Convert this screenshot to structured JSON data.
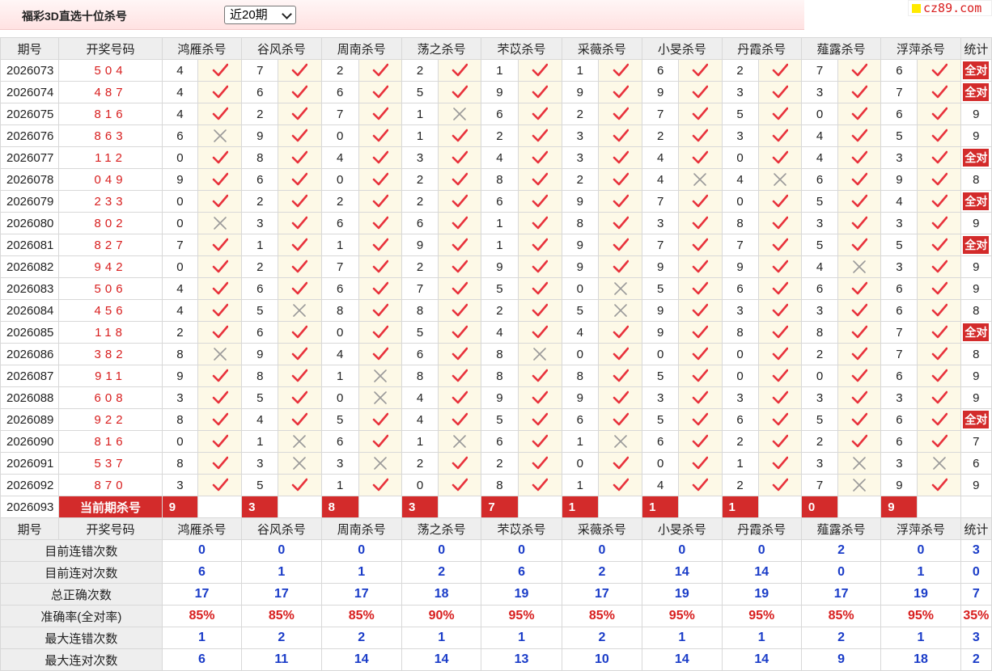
{
  "header": {
    "title": "福彩3D直选十位杀号",
    "period_select": "近20期",
    "site_logo": "cz89.com"
  },
  "columns": [
    "期号",
    "开奖号码",
    "鸿雁杀号",
    "谷风杀号",
    "周南杀号",
    "荡之杀号",
    "芣苡杀号",
    "采薇杀号",
    "小旻杀号",
    "丹霞杀号",
    "薤露杀号",
    "浮萍杀号",
    "统计"
  ],
  "rows": [
    {
      "issue": "2026073",
      "draw": "504",
      "picks": [
        [
          "4",
          "v"
        ],
        [
          "7",
          "v"
        ],
        [
          "2",
          "v"
        ],
        [
          "2",
          "v"
        ],
        [
          "1",
          "v"
        ],
        [
          "1",
          "v"
        ],
        [
          "6",
          "v"
        ],
        [
          "2",
          "v"
        ],
        [
          "7",
          "v"
        ],
        [
          "6",
          "v"
        ]
      ],
      "stat": "全对"
    },
    {
      "issue": "2026074",
      "draw": "487",
      "picks": [
        [
          "4",
          "v"
        ],
        [
          "6",
          "v"
        ],
        [
          "6",
          "v"
        ],
        [
          "5",
          "v"
        ],
        [
          "9",
          "v"
        ],
        [
          "9",
          "v"
        ],
        [
          "9",
          "v"
        ],
        [
          "3",
          "v"
        ],
        [
          "3",
          "v"
        ],
        [
          "7",
          "v"
        ]
      ],
      "stat": "全对"
    },
    {
      "issue": "2026075",
      "draw": "816",
      "picks": [
        [
          "4",
          "v"
        ],
        [
          "2",
          "v"
        ],
        [
          "7",
          "v"
        ],
        [
          "1",
          "x"
        ],
        [
          "6",
          "v"
        ],
        [
          "2",
          "v"
        ],
        [
          "7",
          "v"
        ],
        [
          "5",
          "v"
        ],
        [
          "0",
          "v"
        ],
        [
          "6",
          "v"
        ]
      ],
      "stat": "9"
    },
    {
      "issue": "2026076",
      "draw": "863",
      "picks": [
        [
          "6",
          "x"
        ],
        [
          "9",
          "v"
        ],
        [
          "0",
          "v"
        ],
        [
          "1",
          "v"
        ],
        [
          "2",
          "v"
        ],
        [
          "3",
          "v"
        ],
        [
          "2",
          "v"
        ],
        [
          "3",
          "v"
        ],
        [
          "4",
          "v"
        ],
        [
          "5",
          "v"
        ]
      ],
      "stat": "9"
    },
    {
      "issue": "2026077",
      "draw": "112",
      "picks": [
        [
          "0",
          "v"
        ],
        [
          "8",
          "v"
        ],
        [
          "4",
          "v"
        ],
        [
          "3",
          "v"
        ],
        [
          "4",
          "v"
        ],
        [
          "3",
          "v"
        ],
        [
          "4",
          "v"
        ],
        [
          "0",
          "v"
        ],
        [
          "4",
          "v"
        ],
        [
          "3",
          "v"
        ]
      ],
      "stat": "全对"
    },
    {
      "issue": "2026078",
      "draw": "049",
      "picks": [
        [
          "9",
          "v"
        ],
        [
          "6",
          "v"
        ],
        [
          "0",
          "v"
        ],
        [
          "2",
          "v"
        ],
        [
          "8",
          "v"
        ],
        [
          "2",
          "v"
        ],
        [
          "4",
          "x"
        ],
        [
          "4",
          "x"
        ],
        [
          "6",
          "v"
        ],
        [
          "9",
          "v"
        ]
      ],
      "stat": "8"
    },
    {
      "issue": "2026079",
      "draw": "233",
      "picks": [
        [
          "0",
          "v"
        ],
        [
          "2",
          "v"
        ],
        [
          "2",
          "v"
        ],
        [
          "2",
          "v"
        ],
        [
          "6",
          "v"
        ],
        [
          "9",
          "v"
        ],
        [
          "7",
          "v"
        ],
        [
          "0",
          "v"
        ],
        [
          "5",
          "v"
        ],
        [
          "4",
          "v"
        ]
      ],
      "stat": "全对"
    },
    {
      "issue": "2026080",
      "draw": "802",
      "picks": [
        [
          "0",
          "x"
        ],
        [
          "3",
          "v"
        ],
        [
          "6",
          "v"
        ],
        [
          "6",
          "v"
        ],
        [
          "1",
          "v"
        ],
        [
          "8",
          "v"
        ],
        [
          "3",
          "v"
        ],
        [
          "8",
          "v"
        ],
        [
          "3",
          "v"
        ],
        [
          "3",
          "v"
        ]
      ],
      "stat": "9"
    },
    {
      "issue": "2026081",
      "draw": "827",
      "picks": [
        [
          "7",
          "v"
        ],
        [
          "1",
          "v"
        ],
        [
          "1",
          "v"
        ],
        [
          "9",
          "v"
        ],
        [
          "1",
          "v"
        ],
        [
          "9",
          "v"
        ],
        [
          "7",
          "v"
        ],
        [
          "7",
          "v"
        ],
        [
          "5",
          "v"
        ],
        [
          "5",
          "v"
        ]
      ],
      "stat": "全对"
    },
    {
      "issue": "2026082",
      "draw": "942",
      "picks": [
        [
          "0",
          "v"
        ],
        [
          "2",
          "v"
        ],
        [
          "7",
          "v"
        ],
        [
          "2",
          "v"
        ],
        [
          "9",
          "v"
        ],
        [
          "9",
          "v"
        ],
        [
          "9",
          "v"
        ],
        [
          "9",
          "v"
        ],
        [
          "4",
          "x"
        ],
        [
          "3",
          "v"
        ]
      ],
      "stat": "9"
    },
    {
      "issue": "2026083",
      "draw": "506",
      "picks": [
        [
          "4",
          "v"
        ],
        [
          "6",
          "v"
        ],
        [
          "6",
          "v"
        ],
        [
          "7",
          "v"
        ],
        [
          "5",
          "v"
        ],
        [
          "0",
          "x"
        ],
        [
          "5",
          "v"
        ],
        [
          "6",
          "v"
        ],
        [
          "6",
          "v"
        ],
        [
          "6",
          "v"
        ]
      ],
      "stat": "9"
    },
    {
      "issue": "2026084",
      "draw": "456",
      "picks": [
        [
          "4",
          "v"
        ],
        [
          "5",
          "x"
        ],
        [
          "8",
          "v"
        ],
        [
          "8",
          "v"
        ],
        [
          "2",
          "v"
        ],
        [
          "5",
          "x"
        ],
        [
          "9",
          "v"
        ],
        [
          "3",
          "v"
        ],
        [
          "3",
          "v"
        ],
        [
          "6",
          "v"
        ]
      ],
      "stat": "8"
    },
    {
      "issue": "2026085",
      "draw": "118",
      "picks": [
        [
          "2",
          "v"
        ],
        [
          "6",
          "v"
        ],
        [
          "0",
          "v"
        ],
        [
          "5",
          "v"
        ],
        [
          "4",
          "v"
        ],
        [
          "4",
          "v"
        ],
        [
          "9",
          "v"
        ],
        [
          "8",
          "v"
        ],
        [
          "8",
          "v"
        ],
        [
          "7",
          "v"
        ]
      ],
      "stat": "全对"
    },
    {
      "issue": "2026086",
      "draw": "382",
      "picks": [
        [
          "8",
          "x"
        ],
        [
          "9",
          "v"
        ],
        [
          "4",
          "v"
        ],
        [
          "6",
          "v"
        ],
        [
          "8",
          "x"
        ],
        [
          "0",
          "v"
        ],
        [
          "0",
          "v"
        ],
        [
          "0",
          "v"
        ],
        [
          "2",
          "v"
        ],
        [
          "7",
          "v"
        ]
      ],
      "stat": "8"
    },
    {
      "issue": "2026087",
      "draw": "911",
      "picks": [
        [
          "9",
          "v"
        ],
        [
          "8",
          "v"
        ],
        [
          "1",
          "x"
        ],
        [
          "8",
          "v"
        ],
        [
          "8",
          "v"
        ],
        [
          "8",
          "v"
        ],
        [
          "5",
          "v"
        ],
        [
          "0",
          "v"
        ],
        [
          "0",
          "v"
        ],
        [
          "6",
          "v"
        ]
      ],
      "stat": "9"
    },
    {
      "issue": "2026088",
      "draw": "608",
      "picks": [
        [
          "3",
          "v"
        ],
        [
          "5",
          "v"
        ],
        [
          "0",
          "x"
        ],
        [
          "4",
          "v"
        ],
        [
          "9",
          "v"
        ],
        [
          "9",
          "v"
        ],
        [
          "3",
          "v"
        ],
        [
          "3",
          "v"
        ],
        [
          "3",
          "v"
        ],
        [
          "3",
          "v"
        ]
      ],
      "stat": "9"
    },
    {
      "issue": "2026089",
      "draw": "922",
      "picks": [
        [
          "8",
          "v"
        ],
        [
          "4",
          "v"
        ],
        [
          "5",
          "v"
        ],
        [
          "4",
          "v"
        ],
        [
          "5",
          "v"
        ],
        [
          "6",
          "v"
        ],
        [
          "5",
          "v"
        ],
        [
          "6",
          "v"
        ],
        [
          "5",
          "v"
        ],
        [
          "6",
          "v"
        ]
      ],
      "stat": "全对"
    },
    {
      "issue": "2026090",
      "draw": "816",
      "picks": [
        [
          "0",
          "v"
        ],
        [
          "1",
          "x"
        ],
        [
          "6",
          "v"
        ],
        [
          "1",
          "x"
        ],
        [
          "6",
          "v"
        ],
        [
          "1",
          "x"
        ],
        [
          "6",
          "v"
        ],
        [
          "2",
          "v"
        ],
        [
          "2",
          "v"
        ],
        [
          "6",
          "v"
        ]
      ],
      "stat": "7"
    },
    {
      "issue": "2026091",
      "draw": "537",
      "picks": [
        [
          "8",
          "v"
        ],
        [
          "3",
          "x"
        ],
        [
          "3",
          "x"
        ],
        [
          "2",
          "v"
        ],
        [
          "2",
          "v"
        ],
        [
          "0",
          "v"
        ],
        [
          "0",
          "v"
        ],
        [
          "1",
          "v"
        ],
        [
          "3",
          "x"
        ],
        [
          "3",
          "x"
        ]
      ],
      "stat": "6"
    },
    {
      "issue": "2026092",
      "draw": "870",
      "picks": [
        [
          "3",
          "v"
        ],
        [
          "5",
          "v"
        ],
        [
          "1",
          "v"
        ],
        [
          "0",
          "v"
        ],
        [
          "8",
          "v"
        ],
        [
          "1",
          "v"
        ],
        [
          "4",
          "v"
        ],
        [
          "2",
          "v"
        ],
        [
          "7",
          "x"
        ],
        [
          "9",
          "v"
        ]
      ],
      "stat": "9"
    }
  ],
  "current": {
    "issue": "2026093",
    "label": "当前期杀号",
    "kills": [
      "9",
      "3",
      "8",
      "3",
      "7",
      "1",
      "1",
      "1",
      "0",
      "9"
    ]
  },
  "stats": [
    {
      "label": "目前连错次数",
      "values": [
        "0",
        "0",
        "0",
        "0",
        "0",
        "0",
        "0",
        "0",
        "2",
        "0",
        "3"
      ],
      "red": false
    },
    {
      "label": "目前连对次数",
      "values": [
        "6",
        "1",
        "1",
        "2",
        "6",
        "2",
        "14",
        "14",
        "0",
        "1",
        "0"
      ],
      "red": false
    },
    {
      "label": "总正确次数",
      "values": [
        "17",
        "17",
        "17",
        "18",
        "19",
        "17",
        "19",
        "19",
        "17",
        "19",
        "7"
      ],
      "red": false
    },
    {
      "label": "准确率(全对率)",
      "values": [
        "85%",
        "85%",
        "85%",
        "90%",
        "95%",
        "85%",
        "95%",
        "95%",
        "85%",
        "95%",
        "35%"
      ],
      "red": true
    },
    {
      "label": "最大连错次数",
      "values": [
        "1",
        "2",
        "2",
        "1",
        "1",
        "2",
        "1",
        "1",
        "2",
        "1",
        "3"
      ],
      "red": false
    },
    {
      "label": "最大连对次数",
      "values": [
        "6",
        "11",
        "14",
        "14",
        "13",
        "10",
        "14",
        "14",
        "9",
        "18",
        "2"
      ],
      "red": false
    }
  ],
  "colors": {
    "accent_red": "#d32b2b",
    "draw_red": "#d81e1e",
    "stat_blue": "#1a3cc8",
    "mark_bg": "#fdf9e7",
    "header_bg": "#eeeeee",
    "check_red": "#e8323c",
    "cross_gray": "#9a9a9a"
  }
}
